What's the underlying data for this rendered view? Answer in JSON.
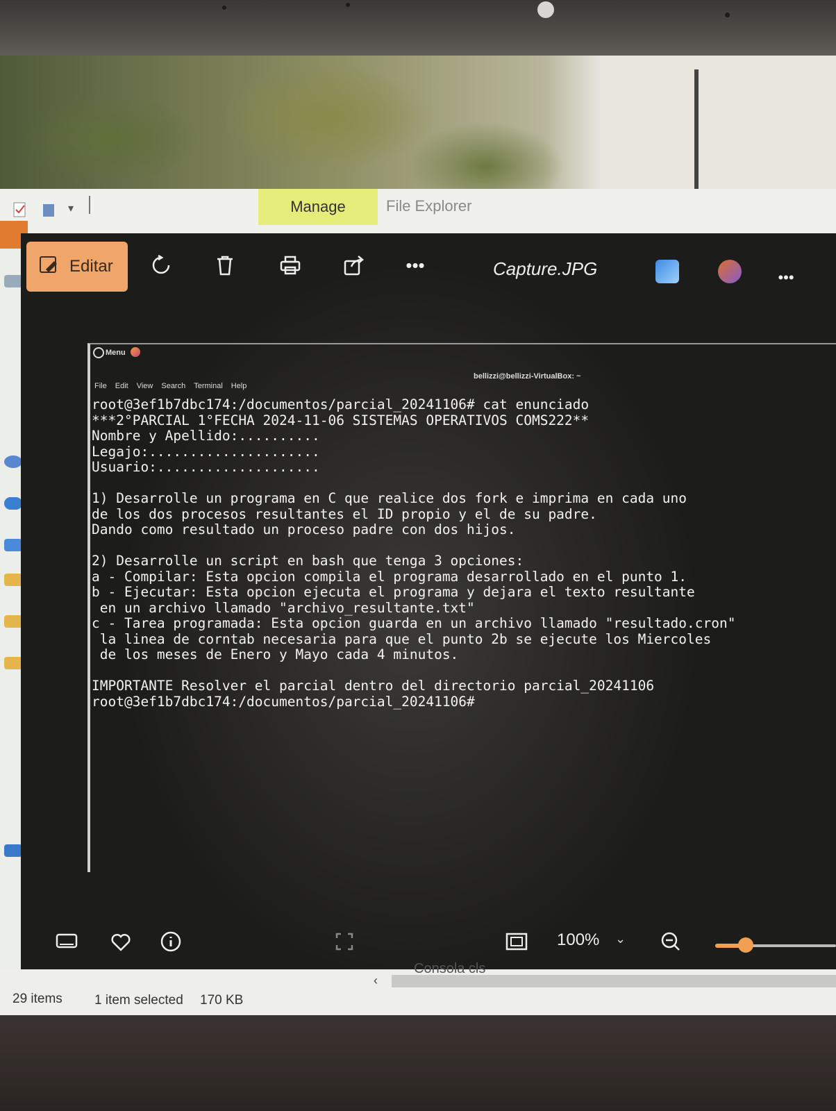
{
  "explorer": {
    "ribbon_tab": "Manage",
    "window_title": "File Explorer",
    "scrolled_file_label": "Consola cls",
    "status": {
      "items_count": "29 items",
      "selection": "1 item selected",
      "size": "170 KB"
    }
  },
  "viewer": {
    "edit_label": "Editar",
    "filename": "Capture.JPG",
    "zoom": "100%",
    "zoom_slider_fraction": 0.25,
    "accent_color": "#f0a56a"
  },
  "terminal": {
    "menu_label": "Menu",
    "window_title": "bellizzi@bellizzi-VirtualBox: ~",
    "menubar": [
      "File",
      "Edit",
      "View",
      "Search",
      "Terminal",
      "Help"
    ],
    "lines": [
      "root@3ef1b7dbc174:/documentos/parcial_20241106# cat enunciado",
      "***2°PARCIAL 1°FECHA 2024-11-06 SISTEMAS OPERATIVOS COMS222**",
      "Nombre y Apellido:..........",
      "Legajo:.....................",
      "Usuario:....................",
      "",
      "1) Desarrolle un programa en C que realice dos fork e imprima en cada uno",
      "de los dos procesos resultantes el ID propio y el de su padre.",
      "Dando como resultado un proceso padre con dos hijos.",
      "",
      "2) Desarrolle un script en bash que tenga 3 opciones:",
      "a - Compilar: Esta opcion compila el programa desarrollado en el punto 1.",
      "b - Ejecutar: Esta opcion ejecuta el programa y dejara el texto resultante",
      " en un archivo llamado \"archivo_resultante.txt\"",
      "c - Tarea programada: Esta opcion guarda en un archivo llamado \"resultado.cron\"",
      " la linea de corntab necesaria para que el punto 2b se ejecute los Miercoles",
      " de los meses de Enero y Mayo cada 4 minutos.",
      "",
      "IMPORTANTE Resolver el parcial dentro del directorio parcial_20241106",
      "root@3ef1b7dbc174:/documentos/parcial_20241106#"
    ]
  }
}
